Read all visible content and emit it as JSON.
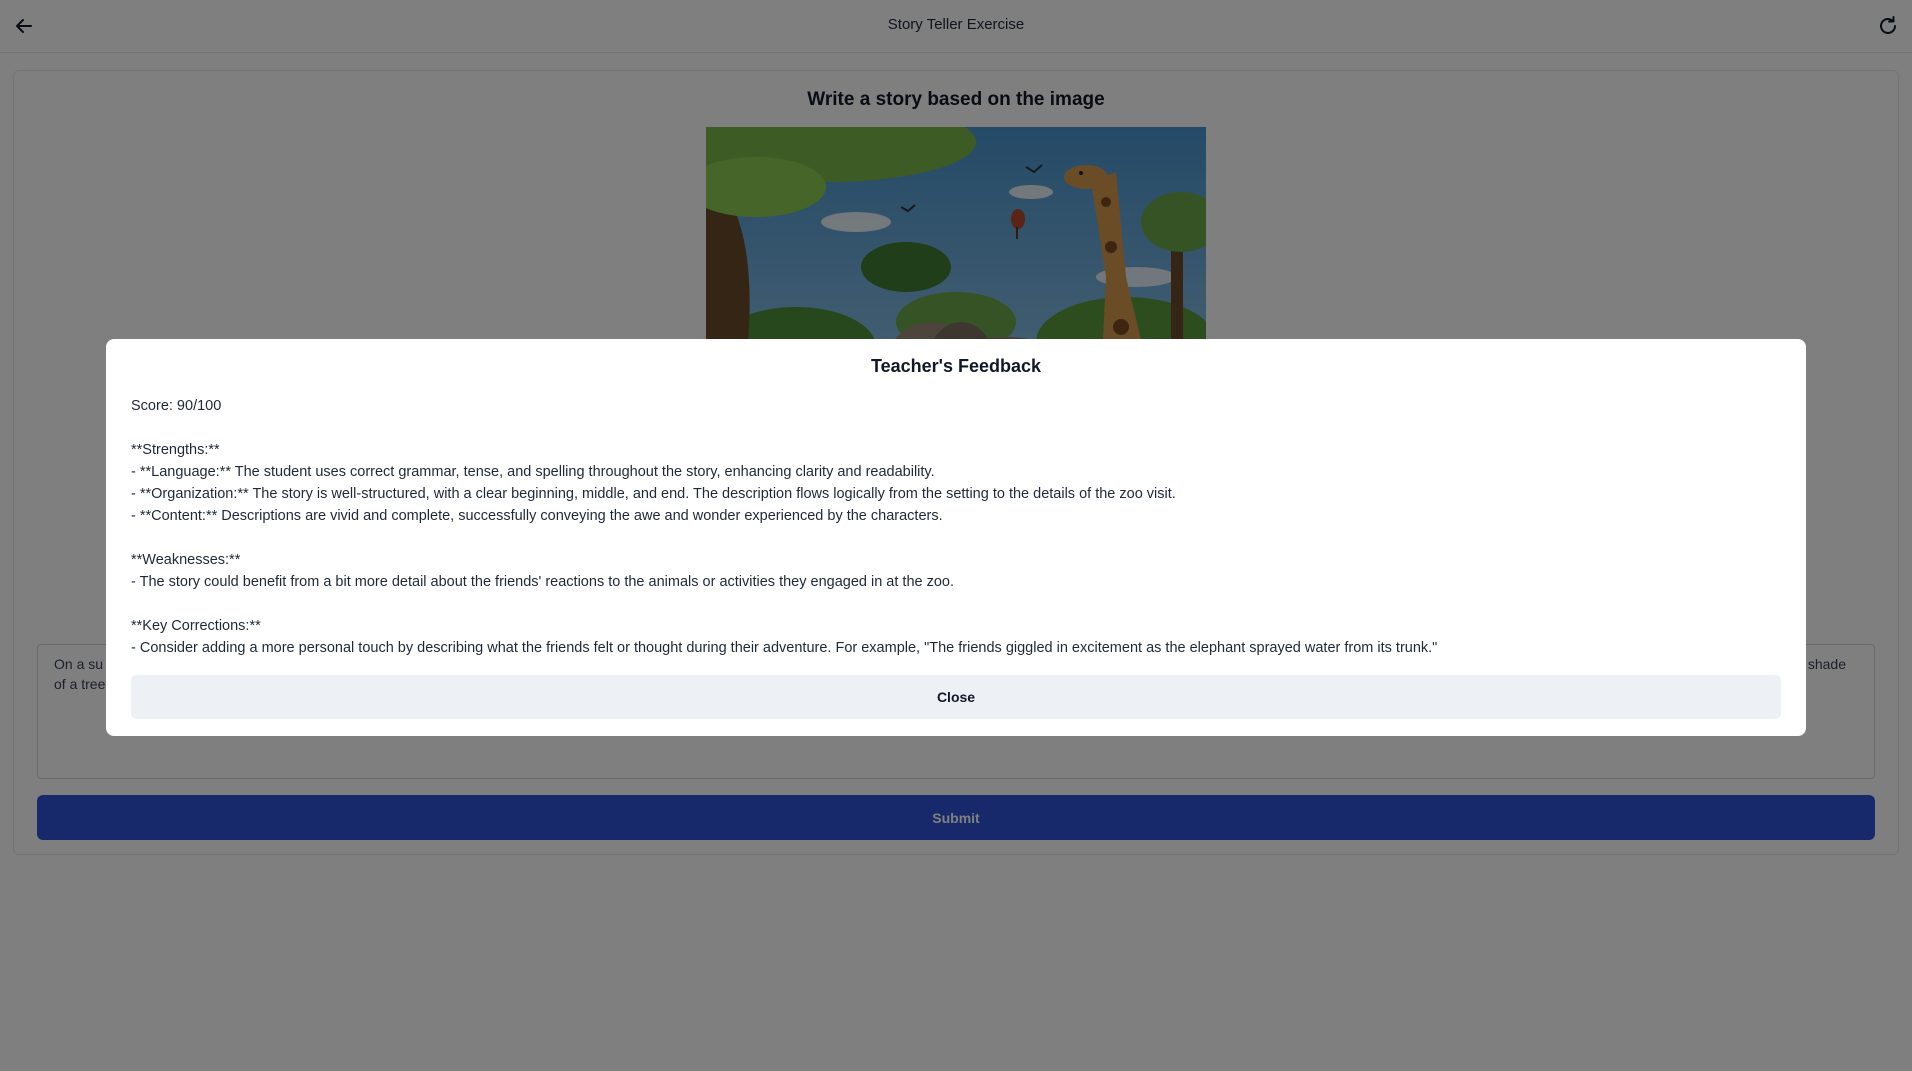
{
  "header": {
    "title": "Story Teller Exercise",
    "back_icon": "arrow-left-icon",
    "refresh_icon": "refresh-icon"
  },
  "exercise": {
    "prompt_title": "Write a story based on the image",
    "image_description_icon": "savanna-animals-illustration",
    "story_text_visible_start": "On a su",
    "story_text_visible_line2": "of a tree",
    "story_text_visible_end": "shade",
    "submit_label": "Submit"
  },
  "feedback_modal": {
    "title": "Teacher's Feedback",
    "score": "Score: 90/100",
    "strengths_heading": "**Strengths:**",
    "strengths": [
      "- **Language:** The student uses correct grammar, tense, and spelling throughout the story, enhancing clarity and readability.",
      "- **Organization:** The story is well-structured, with a clear beginning, middle, and end. The description flows logically from the setting to the details of the zoo visit.",
      "- **Content:** Descriptions are vivid and complete, successfully conveying the awe and wonder experienced by the characters."
    ],
    "weaknesses_heading": "**Weaknesses:**",
    "weaknesses": [
      "- The story could benefit from a bit more detail about the friends' reactions to the animals or activities they engaged in at the zoo."
    ],
    "corrections_heading": "**Key Corrections:**",
    "corrections": [
      "- Consider adding a more personal touch by describing what the friends felt or thought during their adventure. For example, \"The friends giggled in excitement as the elephant sprayed water from its trunk.\""
    ],
    "close_label": "Close"
  },
  "colors": {
    "primary": "#2f52d6",
    "overlay": "rgba(0,0,0,0.5)",
    "close_bg": "#edf0f5"
  }
}
